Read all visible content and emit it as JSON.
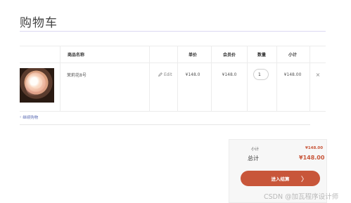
{
  "page": {
    "title": "购物车"
  },
  "table": {
    "headers": {
      "product": "商品名称",
      "unit_price": "单价",
      "member_price": "会员价",
      "quantity": "数量",
      "subtotal": "小计"
    },
    "row": {
      "name": "茉莉花8号",
      "edit_label": "Edit",
      "unit_price": "¥148.0",
      "member_price": "¥148.0",
      "quantity": "1",
      "subtotal": "¥148.00",
      "remove_symbol": "×"
    }
  },
  "continue_shopping": "继续购物",
  "summary": {
    "subtotal_label": "小计",
    "subtotal_value": "¥148.00",
    "total_label": "总计",
    "total_value": "¥148.00",
    "checkout_label": "进入结算",
    "checkout_arrow": "〉"
  },
  "watermark": "CSDN @加瓦程序设计师",
  "colors": {
    "accent": "#c8563a",
    "link": "#5f6fb5"
  },
  "icons": {
    "edit": "pencil-icon",
    "continue": "chevron-left-icon",
    "remove": "close-icon"
  }
}
